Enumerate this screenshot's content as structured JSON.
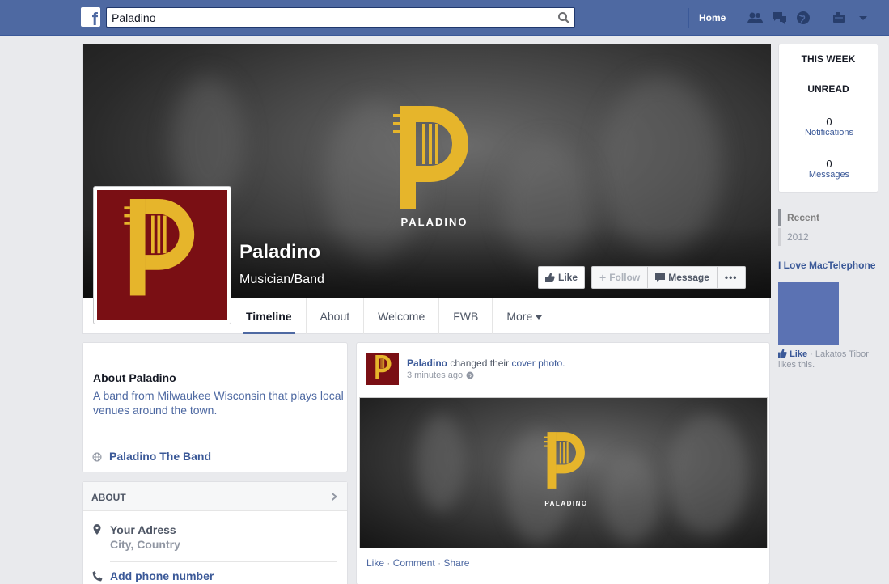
{
  "topbar": {
    "logo": "f",
    "search_value": "Paladino",
    "home_label": "Home",
    "icons": [
      "friends-icon",
      "messages-icon",
      "globe-icon",
      "privacy-icon",
      "chevron-down-icon"
    ]
  },
  "cover": {
    "logo_text": "PALADINO",
    "page_name": "Paladino",
    "page_category": "Musician/Band",
    "like_label": "Like",
    "follow_label": "Follow",
    "message_label": "Message",
    "more_label": "•••"
  },
  "tabs": [
    {
      "label": "Timeline"
    },
    {
      "label": "About"
    },
    {
      "label": "Welcome"
    },
    {
      "label": "FWB"
    },
    {
      "label": "More"
    }
  ],
  "about_card": {
    "title": "About Paladino",
    "description": "A band from Milwaukee Wisconsin that plays local venues around the town.",
    "link": "Paladino The Band"
  },
  "about2_card": {
    "heading": "ABOUT",
    "address_line1": "Your Adress",
    "address_line2": "City, Country",
    "phone": "Add phone number"
  },
  "post": {
    "author": "Paladino",
    "action": "changed their",
    "object": "cover photo.",
    "time": "3 minutes ago",
    "logo_text": "PALADINO",
    "like": "Like",
    "comment": "Comment",
    "share": "Share",
    "sep": "·"
  },
  "sidebar": {
    "this_week": "THIS WEEK",
    "unread": "UNREAD",
    "notifications_count": "0",
    "notifications_label": "Notifications",
    "messages_count": "0",
    "messages_label": "Messages",
    "years": [
      "Recent",
      "2012"
    ],
    "ad_title": "I Love MacTelephone",
    "ad_like": "Like",
    "ad_like_text": "· Lakatos Tibor likes this."
  },
  "colors": {
    "topbar": "#4e69a2",
    "logo_yellow": "#e6b52b",
    "logo_bg": "#7a0f14",
    "link": "#3b5998"
  }
}
